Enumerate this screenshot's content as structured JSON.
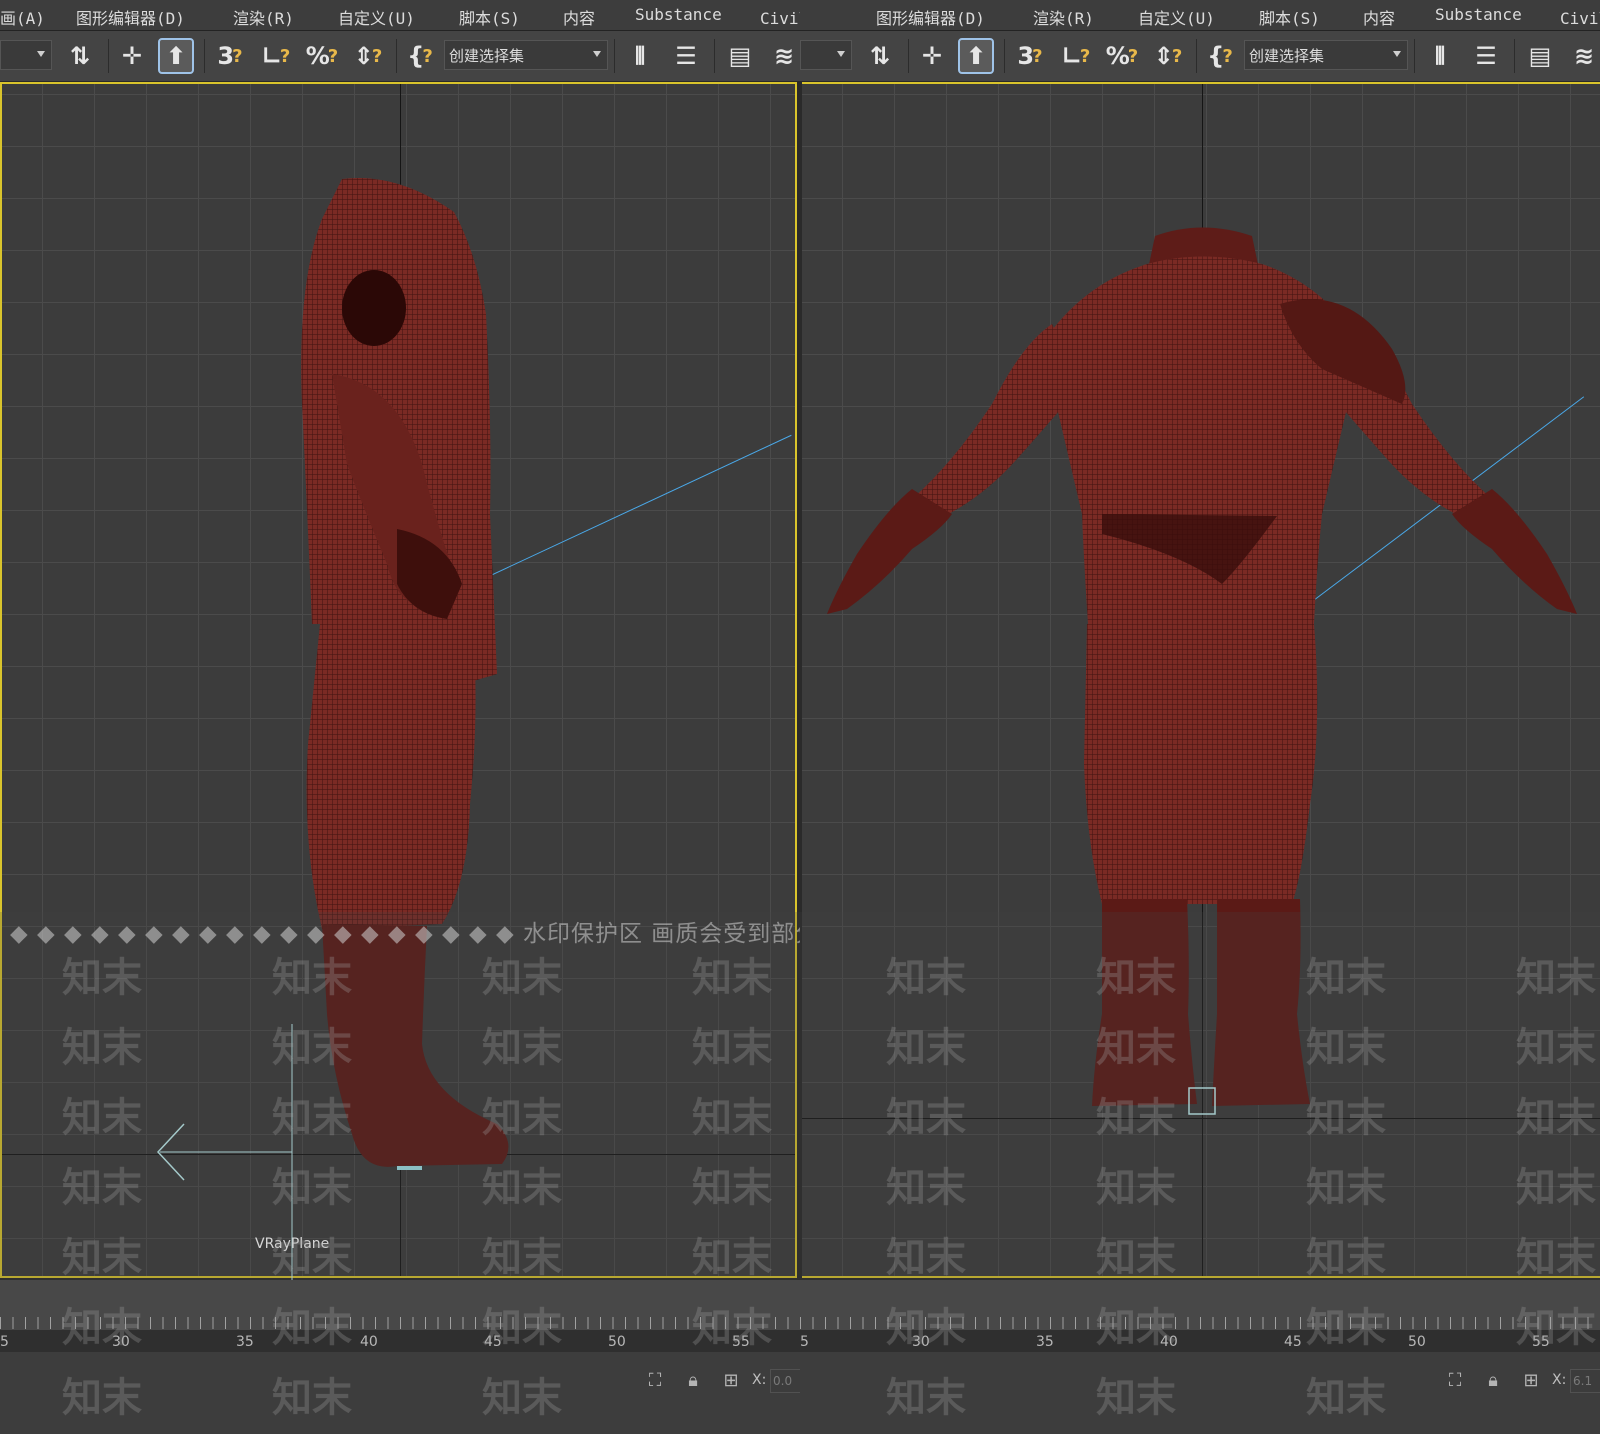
{
  "menubar": {
    "items": [
      "画(A)",
      "图形编辑器(D)",
      "渲染(R)",
      "自定义(U)",
      "脚本(S)",
      "内容",
      "Substance",
      "Civil画(A)"
    ]
  },
  "toolbar": {
    "selection_set_placeholder": "创建选择集"
  },
  "viewport_left": {
    "object_label": "VRayPlane"
  },
  "watermark": {
    "notice": "◆ ◆ ◆ ◆ ◆ ◆ ◆ ◆ ◆ ◆ ◆ ◆ ◆ ◆ ◆ ◆ ◆ ◆ ◆ 水印保护区 画质会受到部分影响 ◆ ◆ ◆ ◆ ◆ ◆ ◆ ◆ ◆ ◆ ◆ ◆ ◆ ◆ ◆ ◆ ◆",
    "tag": "知末"
  },
  "timeline": {
    "ruler_labels": [
      "5",
      "30",
      "35",
      "40",
      "45",
      "50",
      "55"
    ]
  },
  "status": {
    "x_label": "X:",
    "x_value_left": "0.0",
    "x_value_right": "6.1"
  },
  "colors": {
    "viewport_border_active": "#d9c42c",
    "mesh": "#7a2a24",
    "camera_line": "#4aa8e8"
  }
}
